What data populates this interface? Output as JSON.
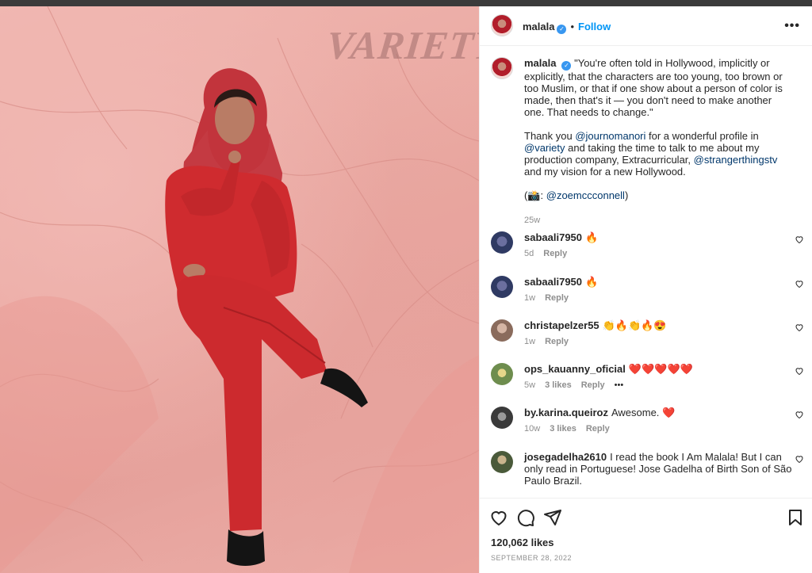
{
  "photo": {
    "magazine_logo": "VARIETY"
  },
  "header": {
    "username": "malala",
    "follow_label": "Follow",
    "more_icon": "more-horizontal-icon"
  },
  "caption": {
    "username": "malala",
    "quote": "\"You're often told in Hollywood, implicitly or explicitly, that the characters are too young, too brown or too Muslim, or that if one show about a person of color is made, then that's it — you don't need to make another one. That needs to change.\"",
    "p2_part1": "Thank you ",
    "mention_journo": "@journomanori",
    "p2_part2": " for a wonderful profile in ",
    "mention_variety": "@variety",
    "p2_part3": " and taking the time to talk to me about my production company, Extracurricular, ",
    "mention_stranger": "@strangerthingstv",
    "p2_part4": " and my vision for a new Hollywood.",
    "credit_prefix": "(📸: ",
    "mention_zoe": "@zoemccconnell",
    "credit_suffix": ")",
    "time": "25w"
  },
  "comments": [
    {
      "username": "sabaali7950",
      "text": "🔥",
      "time": "5d",
      "likes": "",
      "reply": "Reply"
    },
    {
      "username": "sabaali7950",
      "text": "🔥",
      "time": "1w",
      "likes": "",
      "reply": "Reply"
    },
    {
      "username": "christapelzer55",
      "text": "👏🔥👏🔥😍",
      "time": "1w",
      "likes": "",
      "reply": "Reply"
    },
    {
      "username": "ops_kauanny_oficial",
      "text": "❤️❤️❤️❤️❤️",
      "time": "5w",
      "likes": "3 likes",
      "reply": "Reply",
      "more": "•••"
    },
    {
      "username": "by.karina.queiroz",
      "text": "Awesome. ❤️",
      "time": "10w",
      "likes": "3 likes",
      "reply": "Reply"
    },
    {
      "username": "josegadelha2610",
      "text": "I read the book I Am Malala! But I can only read in Portuguese! Jose Gadelha of Birth Son of São Paulo Brazil.",
      "time": "",
      "likes": "",
      "reply": ""
    }
  ],
  "actions": {
    "likes": "120,062 likes",
    "date": "SEPTEMBER 28, 2022"
  },
  "colors": {
    "accent": "#0095f6",
    "mention": "#00376b",
    "muted": "#8e8e8e"
  }
}
